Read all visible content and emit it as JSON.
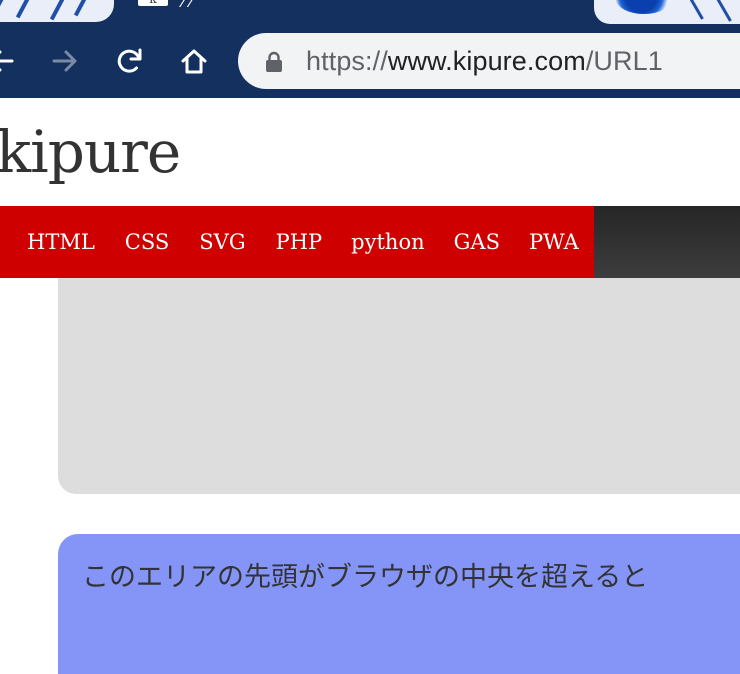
{
  "browser": {
    "tab": {
      "favicon_text": "k"
    },
    "toolbar": {
      "back_icon": "arrow-left-icon",
      "forward_icon": "arrow-right-icon",
      "reload_icon": "reload-icon",
      "home_icon": "home-icon",
      "lock_icon": "lock-icon",
      "url_scheme": "https://",
      "url_host": "www.kipure.com",
      "url_path": "/URL1"
    },
    "colors": {
      "chrome_frame": "#14305e",
      "omnibox_bg": "#f1f3f4"
    }
  },
  "site": {
    "title": "kipure",
    "nav": {
      "items": [
        {
          "label": "HTML"
        },
        {
          "label": "CSS"
        },
        {
          "label": "SVG"
        },
        {
          "label": "PHP"
        },
        {
          "label": "python"
        },
        {
          "label": "GAS"
        },
        {
          "label": "PWA"
        }
      ],
      "accent_color": "#cf0000"
    }
  },
  "content": {
    "placeholder_box_color": "#dddddd",
    "notice_box": {
      "text": "このエリアの先頭がブラウザの中央を超えると",
      "color": "#8495f7"
    }
  }
}
